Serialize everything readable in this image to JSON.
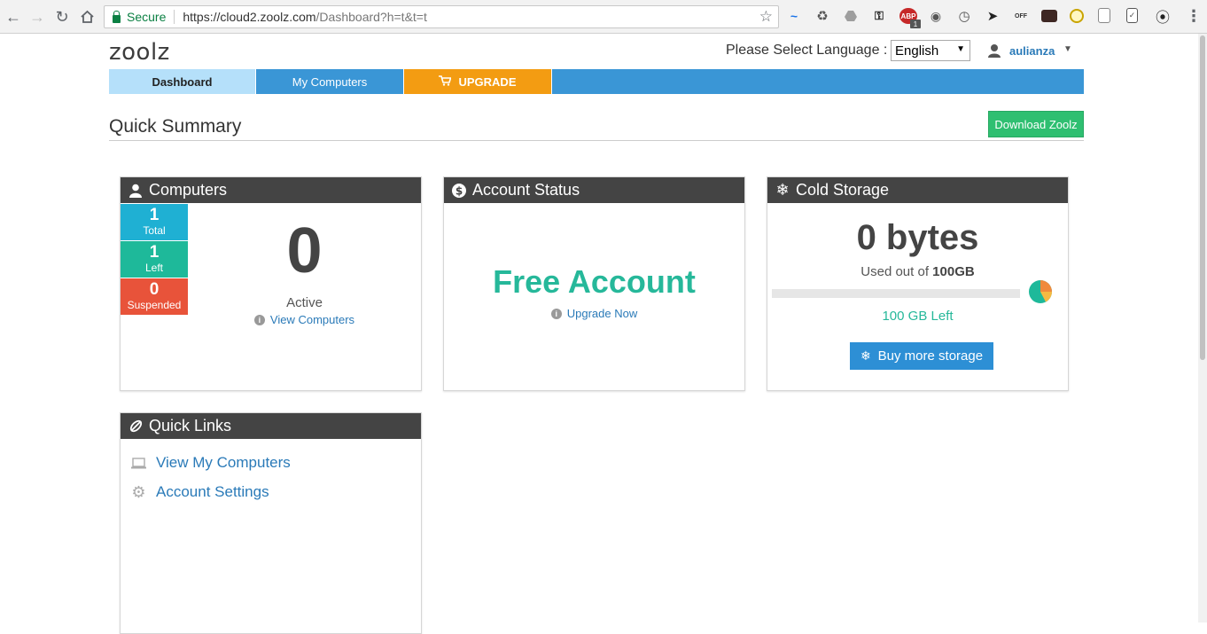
{
  "browser": {
    "secure_label": "Secure",
    "url_host": "https://cloud2.zoolz.com",
    "url_path": "/Dashboard?h=t&t=t",
    "adblock_badge": "1"
  },
  "header": {
    "logo": "zoolz",
    "language_label": "Please Select Language :",
    "language_selected": "English",
    "username": "aulianza"
  },
  "nav": {
    "tabs": [
      {
        "label": "Dashboard"
      },
      {
        "label": "My Computers"
      },
      {
        "label": "UPGRADE"
      }
    ]
  },
  "summary": {
    "title": "Quick Summary",
    "download_button": "Download Zoolz"
  },
  "computers": {
    "title": "Computers",
    "stats": [
      {
        "value": "1",
        "label": "Total",
        "color": "#1fb0d3"
      },
      {
        "value": "1",
        "label": "Left",
        "color": "#1eb99a"
      },
      {
        "value": "0",
        "label": "Suspended",
        "color": "#e8533a"
      }
    ],
    "active_count": "0",
    "active_label": "Active",
    "view_link": "View Computers"
  },
  "account": {
    "title": "Account Status",
    "status": "Free Account",
    "upgrade_link": "Upgrade Now"
  },
  "cold_storage": {
    "title": "Cold Storage",
    "used": "0 bytes",
    "used_prefix": "Used out of",
    "capacity": "100GB",
    "used_fraction": 0,
    "left": "100 GB Left",
    "buy_button": "Buy more storage"
  },
  "quick_links": {
    "title": "Quick Links",
    "items": [
      {
        "label": "View My Computers",
        "icon": "laptop-icon"
      },
      {
        "label": "Account Settings",
        "icon": "gear-icon"
      }
    ]
  },
  "colors": {
    "nav_blue": "#3a96d6",
    "active_tab": "#b5e0fa",
    "upgrade_orange": "#f39c12",
    "download_green": "#2fbf71",
    "teal": "#26b89a",
    "panel_header": "#444444",
    "link_blue": "#2a7ab8"
  }
}
